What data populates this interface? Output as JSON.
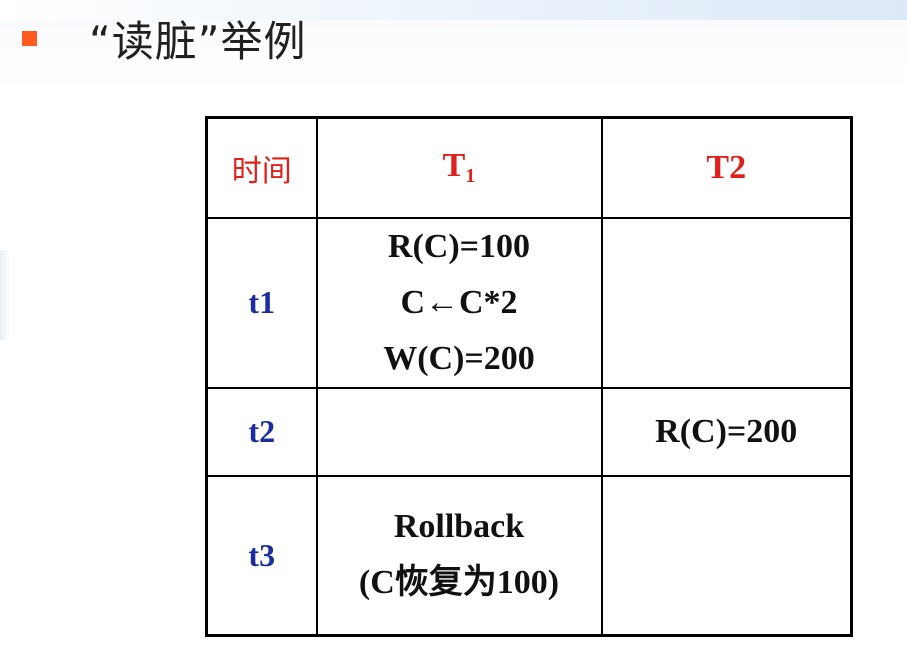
{
  "slide": {
    "title": "“读脏”举例"
  },
  "table": {
    "headers": {
      "time": "时间",
      "t1_main": "T",
      "t1_sub": "1",
      "t2": "T2"
    },
    "rows": [
      {
        "time": "t1",
        "t1_ops": [
          "R(C)=100",
          "C←C*2",
          "W(C)=200"
        ],
        "t2_ops": []
      },
      {
        "time": "t2",
        "t1_ops": [],
        "t2_ops": [
          "R(C)=200"
        ]
      },
      {
        "time": "t3",
        "t1_ops": [
          "Rollback",
          "(C恢复为100)"
        ],
        "t2_ops": []
      }
    ]
  },
  "colors": {
    "bullet": "#ff5a1f",
    "header_text": "#e0201a",
    "time_text": "#1c2e9e",
    "body_text": "#111111"
  }
}
